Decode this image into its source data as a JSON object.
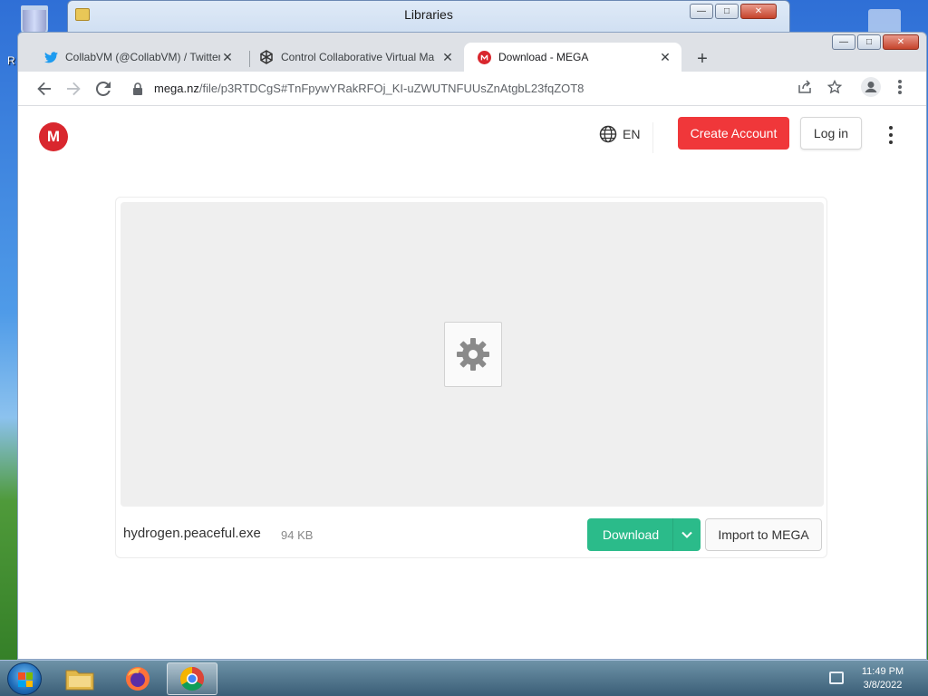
{
  "desktop": {
    "left_label": "R",
    "background_window": {
      "title": "Libraries"
    }
  },
  "browser": {
    "tabs": [
      {
        "title": "CollabVM (@CollabVM) / Twitter",
        "favicon": "twitter-icon"
      },
      {
        "title": "Control Collaborative Virtual Ma",
        "favicon": "collabvm-icon"
      },
      {
        "title": "Download - MEGA",
        "favicon": "mega-icon",
        "active": true
      }
    ],
    "new_tab_label": "+",
    "url_host": "mega.nz",
    "url_path": "/file/p3RTDCgS#TnFpywYRakRFOj_KI-uZWUTNFUUsZnAtgbL23fqZOT8"
  },
  "page": {
    "logo_letter": "M",
    "language": "EN",
    "create_account": "Create Account",
    "log_in": "Log in",
    "file_name": "hydrogen.peaceful.exe",
    "file_size": "94 KB",
    "download": "Download",
    "import": "Import to MEGA"
  },
  "taskbar": {
    "time": "11:49 PM",
    "date": "3/8/2022"
  },
  "colors": {
    "mega_red": "#d9272e",
    "create_account": "#f0373a",
    "download_green": "#2bbb8a"
  }
}
